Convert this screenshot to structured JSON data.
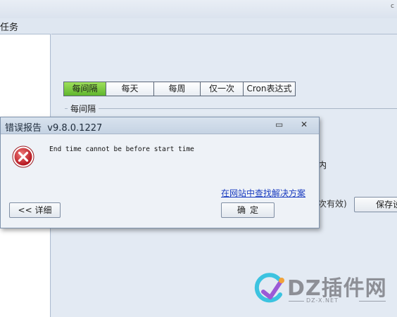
{
  "window": {
    "dot_glyph": "c",
    "task_label": "任务"
  },
  "tabs": [
    {
      "label": "每间隔",
      "active": true
    },
    {
      "label": "每天",
      "active": false
    },
    {
      "label": "每周",
      "active": false
    },
    {
      "label": "仅一次",
      "active": false
    },
    {
      "label": "Cron表达式",
      "active": false
    }
  ],
  "group": {
    "title": "每间隔"
  },
  "background": {
    "nei_text": "内",
    "hint_text": "次有效)",
    "save_button": "保存设"
  },
  "dialog": {
    "title": "错误报告",
    "version": "v9.8.0.1227",
    "minimize_glyph": "▭",
    "close_glyph": "✕",
    "message": "End time cannot be before start time",
    "link": "在网站中查找解决方案",
    "detail_button": "<< 详细",
    "ok_button": "确定"
  },
  "watermark": {
    "brand": "DZ插件网",
    "url": "DZ-X.NET"
  },
  "colors": {
    "active_tab": "#6cc038",
    "error_red": "#c8202a",
    "link_blue": "#1a3cc0"
  },
  "icons": [
    "error-icon",
    "minimize-icon",
    "close-icon",
    "watermark-logo-icon"
  ]
}
